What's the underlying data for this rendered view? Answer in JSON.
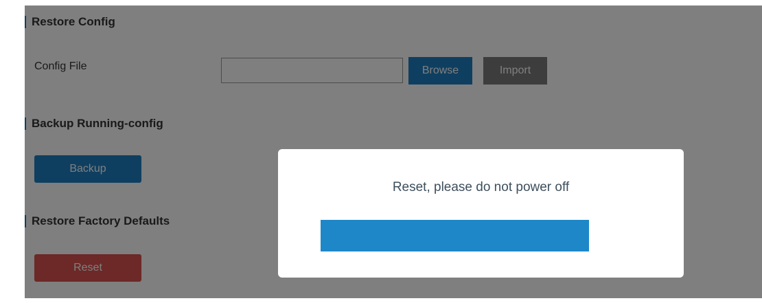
{
  "restore_config": {
    "title": "Restore Config",
    "config_file_label": "Config File",
    "config_file_value": "",
    "browse_label": "Browse",
    "import_label": "Import"
  },
  "backup": {
    "title": "Backup Running-config",
    "backup_label": "Backup"
  },
  "factory": {
    "title": "Restore Factory Defaults",
    "reset_label": "Reset"
  },
  "modal": {
    "message": "Reset, please do not power off",
    "progress_percent": 100
  },
  "colors": {
    "primary_blue": "#1e7fc0",
    "import_gray": "#7b7b7b",
    "reset_red": "#d9534f",
    "progress_blue": "#1e87c8"
  }
}
